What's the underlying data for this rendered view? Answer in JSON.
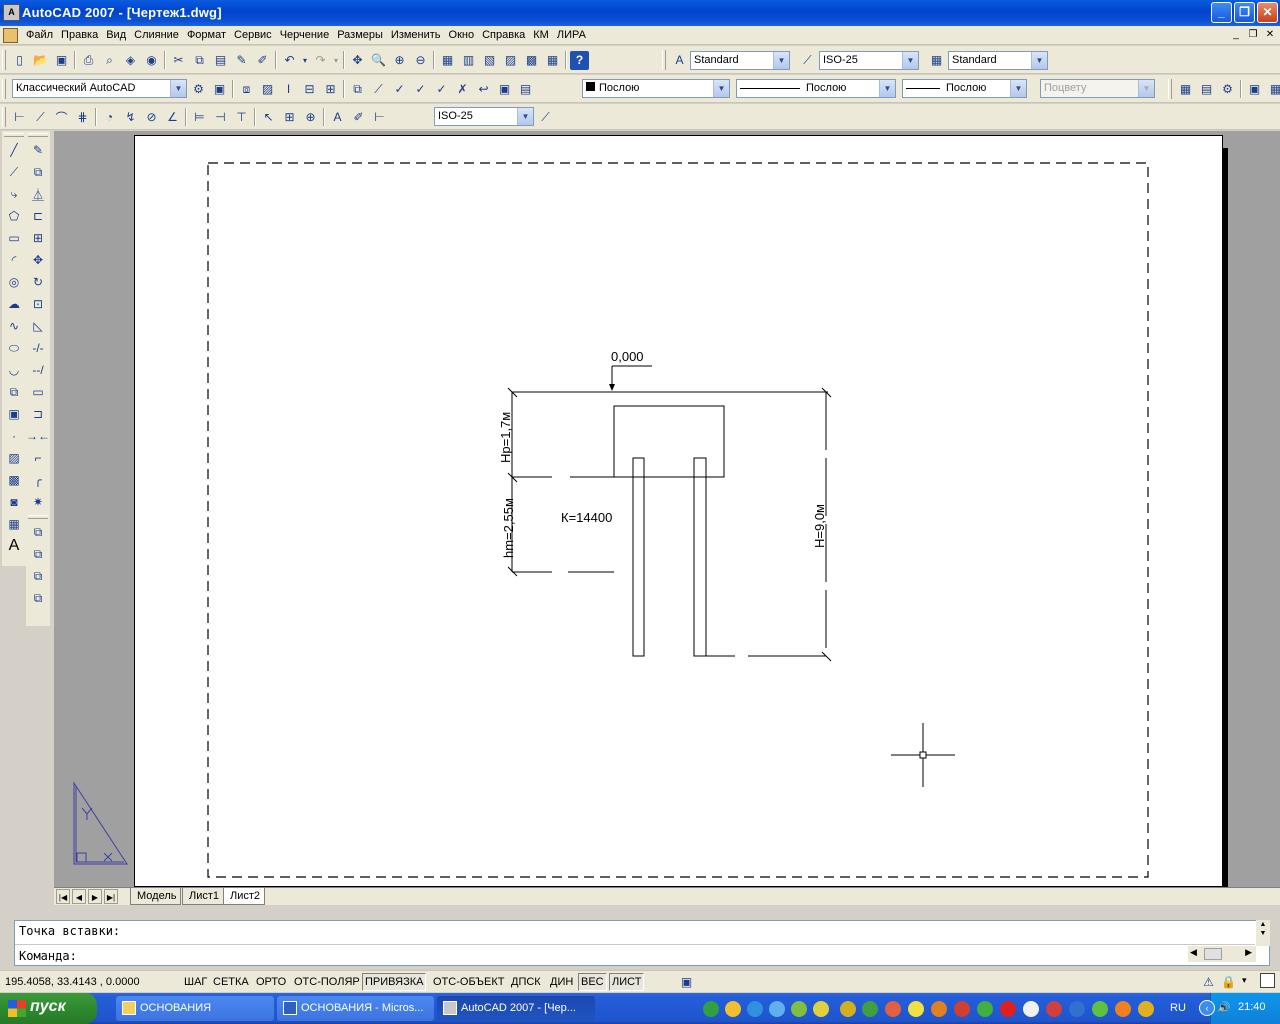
{
  "window": {
    "title": "AutoCAD 2007 - [Чертеж1.dwg]",
    "app_icon_label": "A"
  },
  "menu": {
    "items": [
      "Файл",
      "Правка",
      "Вид",
      "Слияние",
      "Формат",
      "Сервис",
      "Черчение",
      "Размеры",
      "Изменить",
      "Окно",
      "Справка",
      "КМ",
      "ЛИРА"
    ]
  },
  "toolbars": {
    "text_style": "Standard",
    "dim_style": "ISO-25",
    "table_style": "Standard",
    "workspace": "Классический AutoCAD",
    "layer_color": "Послою",
    "linetype": "Послою",
    "lineweight": "Послою",
    "plot_style": "Поцвету",
    "dim_style_2": "ISO-25"
  },
  "drawing": {
    "level_label": "0,000",
    "hp_label": "Hp=1,7м",
    "hm_label": "hm=2,55м",
    "h_label": "H=9,0м",
    "k_label": "К=14400"
  },
  "tabs": {
    "items": [
      "Модель",
      "Лист1",
      "Лист2"
    ],
    "active": "Лист2"
  },
  "command": {
    "line1": "Точка вставки:",
    "line2": "Команда:"
  },
  "status": {
    "coords": "195.4058, 33.4143 , 0.0000",
    "buttons": [
      {
        "label": "ШАГ",
        "on": false
      },
      {
        "label": "СЕТКА",
        "on": false
      },
      {
        "label": "ОРТО",
        "on": false
      },
      {
        "label": "ОТС-ПОЛЯР",
        "on": false
      },
      {
        "label": "ПРИВЯЗКА",
        "on": true
      },
      {
        "label": "ОТС-ОБЪЕКТ",
        "on": false
      },
      {
        "label": "ДПСК",
        "on": false
      },
      {
        "label": "ДИН",
        "on": false
      },
      {
        "label": "ВЕС",
        "on": true
      },
      {
        "label": "ЛИСТ",
        "on": true
      }
    ]
  },
  "taskbar": {
    "start_label": "пуск",
    "tasks": [
      {
        "label": "ОСНОВАНИЯ",
        "active": false
      },
      {
        "label": "ОСНОВАНИЯ - Micros...",
        "active": false
      },
      {
        "label": "AutoCAD 2007 - [Чер...",
        "active": true
      }
    ],
    "lang": "RU",
    "clock": "21:40"
  }
}
